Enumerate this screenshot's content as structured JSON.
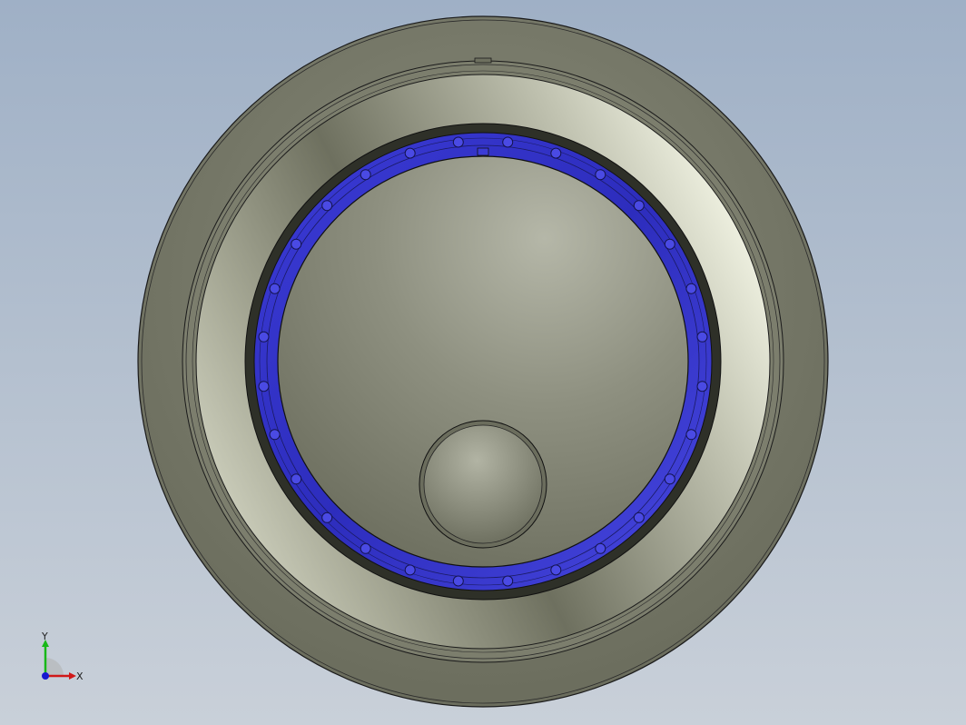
{
  "viewport": {
    "name": "3D model view",
    "background_top": "#9fb0c6",
    "background_bottom": "#c9d0d9"
  },
  "model": {
    "body_color": "#7a7c6c",
    "seal_ring_color": "#3a3acf",
    "bolt_hole_count": 28
  },
  "triad": {
    "x_label": "X",
    "y_label": "Y",
    "x_color": "#d01818",
    "y_color": "#18b818",
    "z_color": "#1818d0"
  }
}
